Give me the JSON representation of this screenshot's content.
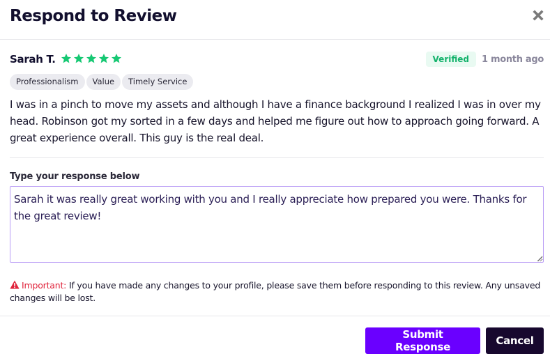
{
  "header": {
    "title": "Respond to Review",
    "close_icon": "close-x-icon"
  },
  "review": {
    "reviewer_name": "Sarah T.",
    "rating": 5,
    "rating_max": 5,
    "star_color": "#16c873",
    "verified_label": "Verified",
    "time_ago": "1 month ago",
    "tags": [
      "Professionalism",
      "Value",
      "Timely Service"
    ],
    "text": "I was in a pinch to move my assets and although I have a finance background I realized I was in over my head. Robinson got my sorted in a few days and helped me figure out how to approach going forward. A great experience overall. This guy is the real deal."
  },
  "response": {
    "label": "Type your response below",
    "value": "Sarah it was really great working with you and I really appreciate how prepared you were. Thanks for the great review!"
  },
  "notice": {
    "icon": "warning-triangle-icon",
    "label": "Important:",
    "text": " If you have made any changes to your profile, please save them before responding to this review. Any unsaved changes will be lost."
  },
  "footer": {
    "submit_label": "Submit Response",
    "cancel_label": "Cancel"
  },
  "colors": {
    "accent": "#6a00ff",
    "dark": "#17082e",
    "danger": "#e0243c",
    "success": "#13b26b"
  }
}
